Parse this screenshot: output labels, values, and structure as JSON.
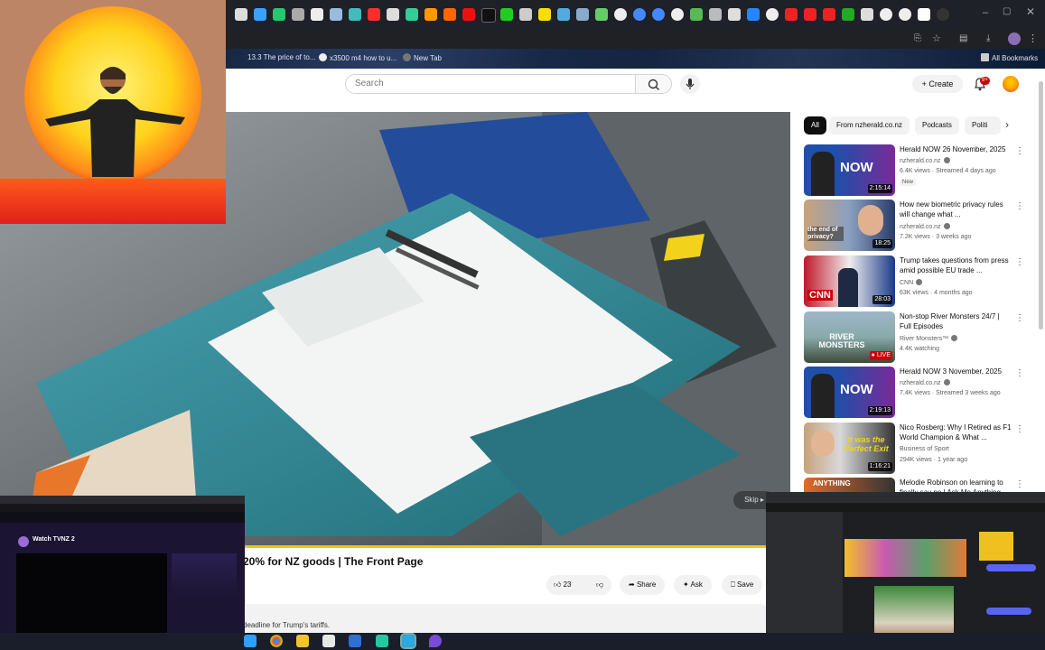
{
  "browser": {
    "bookmarks": [
      {
        "label": "13.3 The price of to..."
      },
      {
        "label": "x3500 m4 how to u..."
      },
      {
        "label": "New Tab"
      }
    ],
    "all_bookmarks": "All Bookmarks"
  },
  "youtube": {
    "search_placeholder": "Search",
    "create_label": "Create",
    "notification_count": "9+",
    "chips": [
      "All",
      "From nzherald.co.nz",
      "Podcasts",
      "Politi"
    ],
    "video_title": "20% for NZ goods | The Front Page",
    "skip_label": "Skip",
    "actions": {
      "like_count": "23",
      "share": "Share",
      "ask": "Ask",
      "save": "Save"
    },
    "description_snippet": "deadline for Trump's tariffs.",
    "recommendations": [
      {
        "title": "Herald NOW 26 November, 2025",
        "channel": "nzherald.co.nz",
        "meta": "6.4K views · Streamed 4 days ago",
        "badge": "New",
        "duration": "2:15:14",
        "thumb_text": "NOW"
      },
      {
        "title": "How new biometric privacy rules will change what ...",
        "channel": "nzherald.co.nz",
        "meta": "7.2K views · 3 weeks ago",
        "duration": "18:25",
        "thumb_text": "the end of privacy?"
      },
      {
        "title": "Trump takes questions from press amid possible EU trade ...",
        "channel": "CNN",
        "meta": "63K views · 4 months ago",
        "duration": "28:03",
        "thumb_text": "CNN"
      },
      {
        "title": "Non-stop River Monsters 24/7 | Full Episodes",
        "channel": "River Monsters™",
        "meta": "4.4K watching",
        "duration": "LIVE",
        "thumb_text": "RIVER MONSTERS"
      },
      {
        "title": "Herald NOW 3 November, 2025",
        "channel": "nzherald.co.nz",
        "meta": "7.4K views · Streamed 3 weeks ago",
        "duration": "2:19:13",
        "thumb_text": "NOW"
      },
      {
        "title": "Nico Rosberg: Why I Retired as F1 World Champion & What ...",
        "channel": "Business of Sport",
        "meta": "294K views · 1 year ago",
        "duration": "1:16:21",
        "thumb_text": "It was the Perfect Exit"
      },
      {
        "title": "Melodie Robinson on learning to finally say no | Ask Me Anything",
        "channel": "",
        "meta": "",
        "duration": "",
        "thumb_text": "ANYTHING"
      }
    ]
  },
  "overlays": {
    "tvnz_title": "Watch TVNZ 2"
  },
  "colors": {
    "progress": "#f5c400",
    "live": "#cc0000",
    "herald_blue": "#1f4fa8"
  }
}
